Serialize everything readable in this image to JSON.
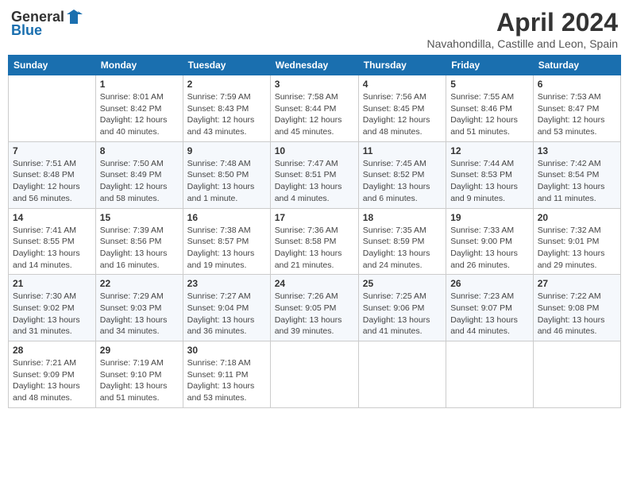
{
  "header": {
    "logo_general": "General",
    "logo_blue": "Blue",
    "title": "April 2024",
    "location": "Navahondilla, Castille and Leon, Spain"
  },
  "columns": [
    "Sunday",
    "Monday",
    "Tuesday",
    "Wednesday",
    "Thursday",
    "Friday",
    "Saturday"
  ],
  "weeks": [
    [
      {
        "day": "",
        "info": ""
      },
      {
        "day": "1",
        "info": "Sunrise: 8:01 AM\nSunset: 8:42 PM\nDaylight: 12 hours\nand 40 minutes."
      },
      {
        "day": "2",
        "info": "Sunrise: 7:59 AM\nSunset: 8:43 PM\nDaylight: 12 hours\nand 43 minutes."
      },
      {
        "day": "3",
        "info": "Sunrise: 7:58 AM\nSunset: 8:44 PM\nDaylight: 12 hours\nand 45 minutes."
      },
      {
        "day": "4",
        "info": "Sunrise: 7:56 AM\nSunset: 8:45 PM\nDaylight: 12 hours\nand 48 minutes."
      },
      {
        "day": "5",
        "info": "Sunrise: 7:55 AM\nSunset: 8:46 PM\nDaylight: 12 hours\nand 51 minutes."
      },
      {
        "day": "6",
        "info": "Sunrise: 7:53 AM\nSunset: 8:47 PM\nDaylight: 12 hours\nand 53 minutes."
      }
    ],
    [
      {
        "day": "7",
        "info": "Sunrise: 7:51 AM\nSunset: 8:48 PM\nDaylight: 12 hours\nand 56 minutes."
      },
      {
        "day": "8",
        "info": "Sunrise: 7:50 AM\nSunset: 8:49 PM\nDaylight: 12 hours\nand 58 minutes."
      },
      {
        "day": "9",
        "info": "Sunrise: 7:48 AM\nSunset: 8:50 PM\nDaylight: 13 hours\nand 1 minute."
      },
      {
        "day": "10",
        "info": "Sunrise: 7:47 AM\nSunset: 8:51 PM\nDaylight: 13 hours\nand 4 minutes."
      },
      {
        "day": "11",
        "info": "Sunrise: 7:45 AM\nSunset: 8:52 PM\nDaylight: 13 hours\nand 6 minutes."
      },
      {
        "day": "12",
        "info": "Sunrise: 7:44 AM\nSunset: 8:53 PM\nDaylight: 13 hours\nand 9 minutes."
      },
      {
        "day": "13",
        "info": "Sunrise: 7:42 AM\nSunset: 8:54 PM\nDaylight: 13 hours\nand 11 minutes."
      }
    ],
    [
      {
        "day": "14",
        "info": "Sunrise: 7:41 AM\nSunset: 8:55 PM\nDaylight: 13 hours\nand 14 minutes."
      },
      {
        "day": "15",
        "info": "Sunrise: 7:39 AM\nSunset: 8:56 PM\nDaylight: 13 hours\nand 16 minutes."
      },
      {
        "day": "16",
        "info": "Sunrise: 7:38 AM\nSunset: 8:57 PM\nDaylight: 13 hours\nand 19 minutes."
      },
      {
        "day": "17",
        "info": "Sunrise: 7:36 AM\nSunset: 8:58 PM\nDaylight: 13 hours\nand 21 minutes."
      },
      {
        "day": "18",
        "info": "Sunrise: 7:35 AM\nSunset: 8:59 PM\nDaylight: 13 hours\nand 24 minutes."
      },
      {
        "day": "19",
        "info": "Sunrise: 7:33 AM\nSunset: 9:00 PM\nDaylight: 13 hours\nand 26 minutes."
      },
      {
        "day": "20",
        "info": "Sunrise: 7:32 AM\nSunset: 9:01 PM\nDaylight: 13 hours\nand 29 minutes."
      }
    ],
    [
      {
        "day": "21",
        "info": "Sunrise: 7:30 AM\nSunset: 9:02 PM\nDaylight: 13 hours\nand 31 minutes."
      },
      {
        "day": "22",
        "info": "Sunrise: 7:29 AM\nSunset: 9:03 PM\nDaylight: 13 hours\nand 34 minutes."
      },
      {
        "day": "23",
        "info": "Sunrise: 7:27 AM\nSunset: 9:04 PM\nDaylight: 13 hours\nand 36 minutes."
      },
      {
        "day": "24",
        "info": "Sunrise: 7:26 AM\nSunset: 9:05 PM\nDaylight: 13 hours\nand 39 minutes."
      },
      {
        "day": "25",
        "info": "Sunrise: 7:25 AM\nSunset: 9:06 PM\nDaylight: 13 hours\nand 41 minutes."
      },
      {
        "day": "26",
        "info": "Sunrise: 7:23 AM\nSunset: 9:07 PM\nDaylight: 13 hours\nand 44 minutes."
      },
      {
        "day": "27",
        "info": "Sunrise: 7:22 AM\nSunset: 9:08 PM\nDaylight: 13 hours\nand 46 minutes."
      }
    ],
    [
      {
        "day": "28",
        "info": "Sunrise: 7:21 AM\nSunset: 9:09 PM\nDaylight: 13 hours\nand 48 minutes."
      },
      {
        "day": "29",
        "info": "Sunrise: 7:19 AM\nSunset: 9:10 PM\nDaylight: 13 hours\nand 51 minutes."
      },
      {
        "day": "30",
        "info": "Sunrise: 7:18 AM\nSunset: 9:11 PM\nDaylight: 13 hours\nand 53 minutes."
      },
      {
        "day": "",
        "info": ""
      },
      {
        "day": "",
        "info": ""
      },
      {
        "day": "",
        "info": ""
      },
      {
        "day": "",
        "info": ""
      }
    ]
  ]
}
